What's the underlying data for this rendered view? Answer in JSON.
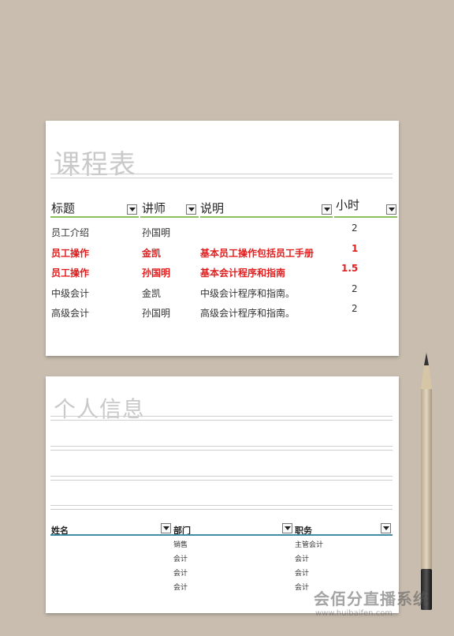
{
  "course": {
    "title": "课程表",
    "headers": {
      "topic": "标题",
      "lecturer": "讲师",
      "desc": "说明",
      "hours": "小时"
    },
    "rows": [
      {
        "topic": "员工介绍",
        "lecturer": "孙国明",
        "desc": "",
        "hours": "2",
        "highlight": false
      },
      {
        "topic": "员工操作",
        "lecturer": "金凯",
        "desc": "基本员工操作包括员工手册",
        "hours": "1",
        "highlight": true
      },
      {
        "topic": "员工操作",
        "lecturer": "孙国明",
        "desc": "基本会计程序和指南",
        "hours": "1.5",
        "highlight": true
      },
      {
        "topic": "中级会计",
        "lecturer": "金凯",
        "desc": "中级会计程序和指南。",
        "hours": "2",
        "highlight": false
      },
      {
        "topic": "高级会计",
        "lecturer": "孙国明",
        "desc": "高级会计程序和指南。",
        "hours": "2",
        "highlight": false
      }
    ]
  },
  "personal": {
    "title": "个人信息",
    "headers": {
      "name": "姓名",
      "dept": "部门",
      "role": "职务"
    },
    "rows": [
      {
        "name": "",
        "dept": "销售",
        "role": "主管会计"
      },
      {
        "name": "",
        "dept": "会计",
        "role": "会计"
      },
      {
        "name": "",
        "dept": "会计",
        "role": "会计"
      },
      {
        "name": "",
        "dept": "会计",
        "role": "会计"
      }
    ]
  },
  "watermark": {
    "name": "会佰分直播系统",
    "url": "www.huibaifen.com"
  },
  "colors": {
    "accent_green": "#8cbf5e",
    "accent_teal": "#3f8ea3",
    "highlight_red": "#e02020"
  }
}
